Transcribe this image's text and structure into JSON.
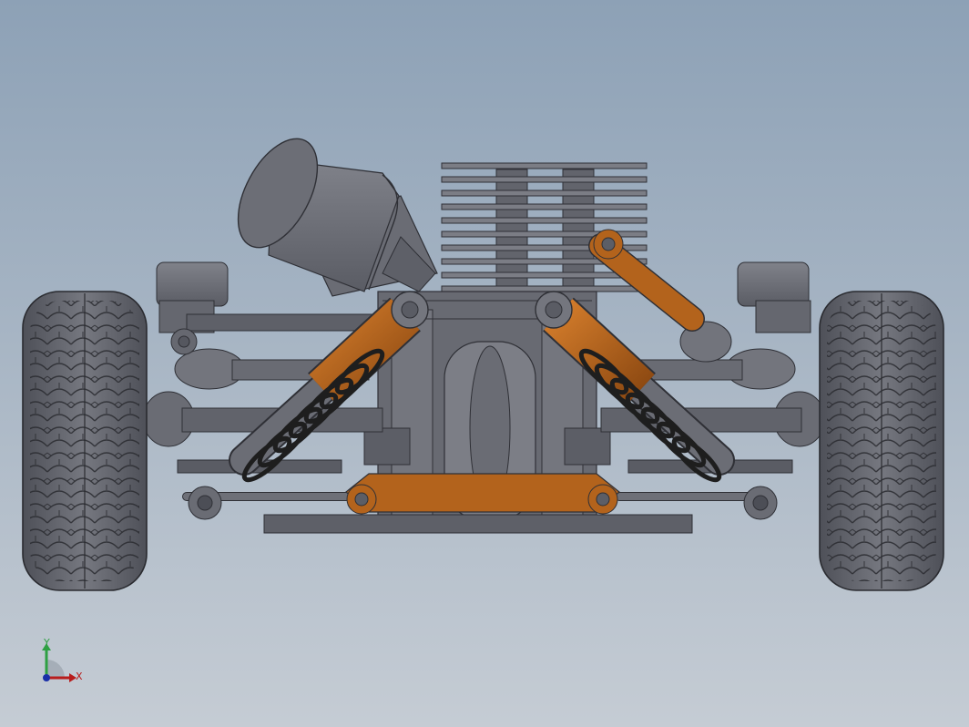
{
  "viewport": {
    "background_top": "#8da1b6",
    "background_bottom": "#c5ccd4",
    "model_gray": "#6e7078",
    "model_orange": "#b3631c",
    "spring_color": "#1e1e1e"
  },
  "triad": {
    "y_label": "Y",
    "x_label": "X",
    "y_color": "#2ea043",
    "x_color": "#b81c1c",
    "z_color": "#1a2fa8"
  }
}
